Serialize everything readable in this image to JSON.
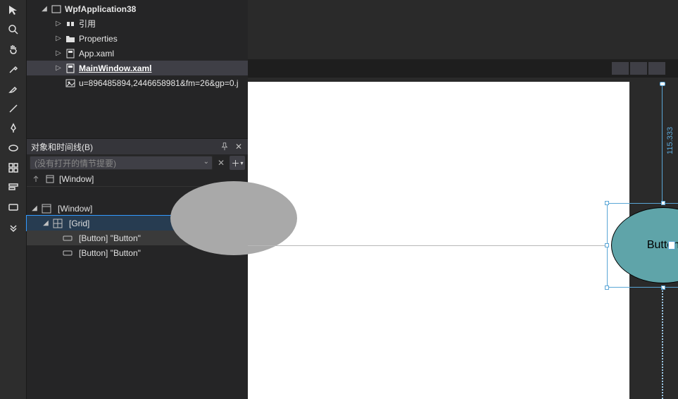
{
  "project": {
    "root_name": "WpfApplication38",
    "references_label": "引用",
    "properties_label": "Properties",
    "app_xaml_label": "App.xaml",
    "main_window_label": "MainWindow.xaml",
    "image_asset_label": "u=896485894,2446658981&fm=26&gp=0.j"
  },
  "objects_panel": {
    "title": "对象和时间线(B)",
    "storyboard_placeholder": "(没有打开的情节提要)",
    "scope_label": "[Window]",
    "tree": {
      "window_label": "[Window]",
      "grid_label": "[Grid]",
      "button1_label": "[Button] \"Button\"",
      "button2_label": "[Button] \"Button\""
    }
  },
  "canvas": {
    "button_text": "Button",
    "top_margin_value": "115.333"
  }
}
